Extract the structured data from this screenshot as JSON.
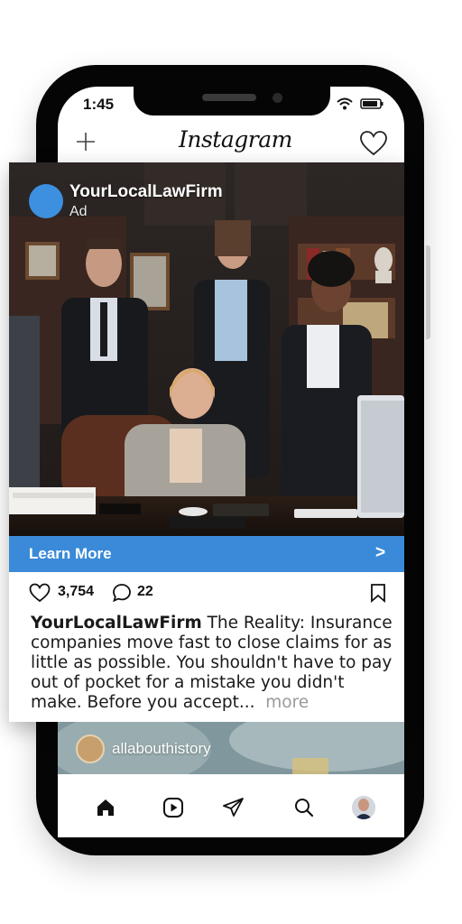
{
  "status_bar": {
    "time": "1:45",
    "icons": [
      "wifi-icon",
      "battery-icon"
    ]
  },
  "header": {
    "logo": "Instagram",
    "left_icon": "plus-icon",
    "right_icon": "heart-icon"
  },
  "ad": {
    "account": "YourLocalLawFirm",
    "label": "Ad",
    "cta": "Learn More",
    "cta_arrow": ">",
    "likes": "3,754",
    "comments": "22",
    "caption_user": "YourLocalLawFirm",
    "caption_text": " The Reality: Insurance companies move fast to close claims for as little as possible. You shouldn't have to pay out of pocket for a mistake you didn't make. Before you accept...",
    "more": "more"
  },
  "next_post": {
    "username": "allabouthistory"
  },
  "bottom_nav": [
    "home-icon",
    "reels-icon",
    "send-icon",
    "search-icon",
    "profile-avatar"
  ],
  "colors": {
    "cta": "#3b8ad9",
    "ad_avatar": "#3d8fe0",
    "phone_frame": "#050505"
  }
}
